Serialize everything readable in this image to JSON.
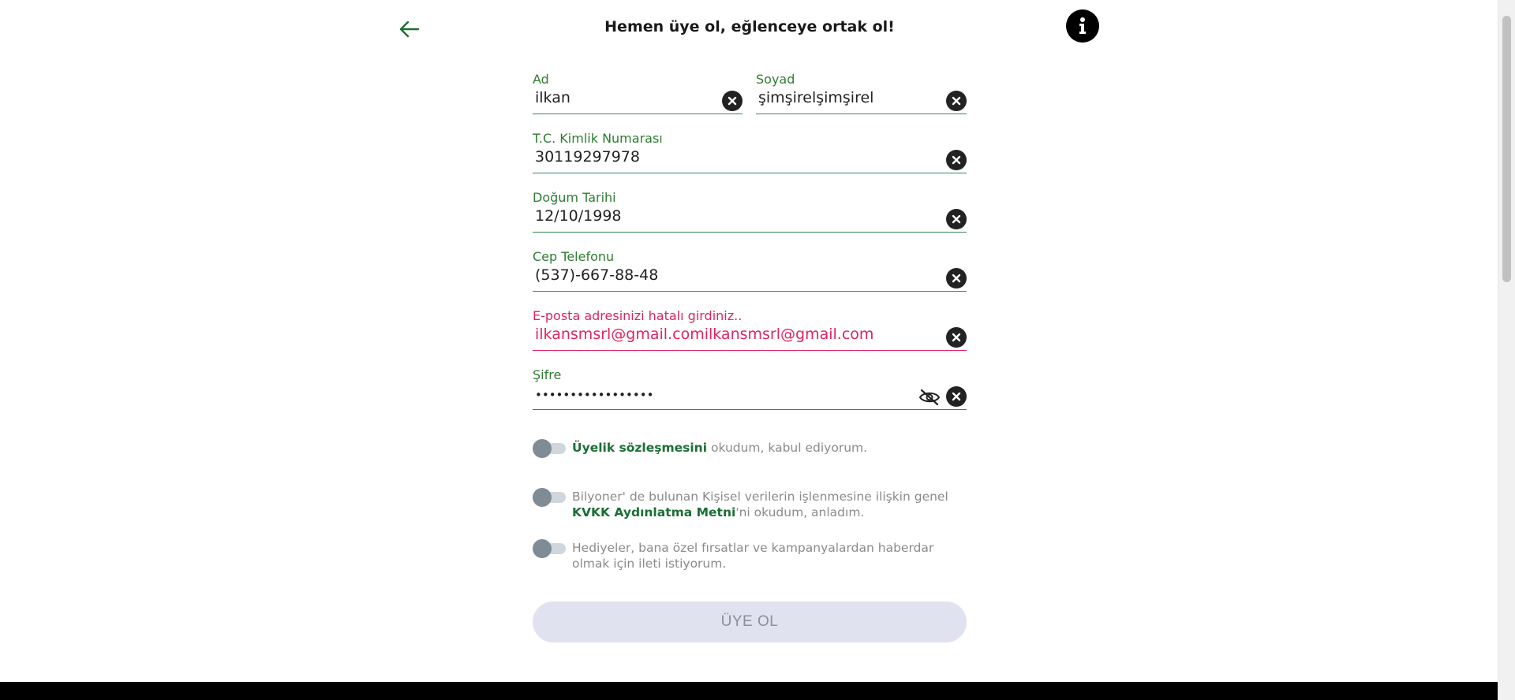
{
  "header": {
    "title": "Hemen üye ol, eğlenceye ortak ol!"
  },
  "form": {
    "first_name": {
      "label": "Ad",
      "value": "ilkan"
    },
    "last_name": {
      "label": "Soyad",
      "value": "şimşirelşimşirel"
    },
    "tc_id": {
      "label": "T.C. Kimlik Numarası",
      "value": "30119297978"
    },
    "birth_date": {
      "label": "Doğum Tarihi",
      "value": "12/10/1998"
    },
    "phone": {
      "label": "Cep Telefonu",
      "value": "(537)-667-88-48"
    },
    "email": {
      "label": "E-posta adresinizi hatalı girdiniz..",
      "value": "ilkansmsrl@gmail.comilkansmsrl@gmail.com",
      "state": "error"
    },
    "password": {
      "label": "Şifre",
      "value": "•••••••••••••••••"
    }
  },
  "consents": {
    "membership": {
      "link": "Üyelik sözleşmesini",
      "text": " okudum, kabul ediyorum.",
      "checked": false
    },
    "kvkk": {
      "text_before": "Bilyoner' de bulunan Kişisel verilerin işlenmesine ilişkin genel ",
      "link": "KVKK Aydınlatma Metni",
      "text_after": "'ni okudum, anladım.",
      "checked": false
    },
    "marketing": {
      "text": "Hediyeler, bana özel fırsatlar ve kampanyalardan haberdar olmak için ileti istiyorum.",
      "checked": false
    }
  },
  "submit": {
    "label": "ÜYE OL",
    "enabled": false
  },
  "colors": {
    "accent_green": "#2e7d32",
    "error_pink": "#e0245e",
    "button_disabled_bg": "#e0e3ef"
  },
  "icons": {
    "back": "arrow-left-icon",
    "info": "info-icon",
    "clear": "close-circle-icon",
    "visibility": "eye-off-icon"
  }
}
